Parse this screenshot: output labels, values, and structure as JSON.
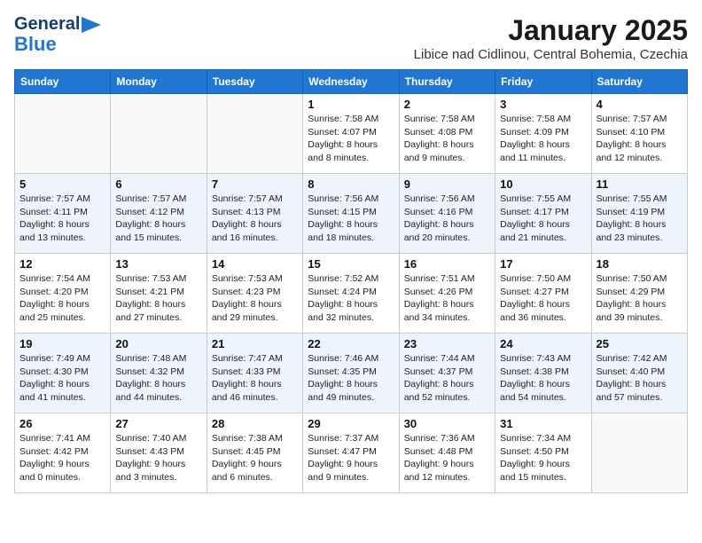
{
  "logo": {
    "line1": "General",
    "line2": "Blue",
    "flag_shape": "triangle"
  },
  "title": "January 2025",
  "subtitle": "Libice nad Cidlinou, Central Bohemia, Czechia",
  "days_of_week": [
    "Sunday",
    "Monday",
    "Tuesday",
    "Wednesday",
    "Thursday",
    "Friday",
    "Saturday"
  ],
  "weeks": [
    [
      {
        "day": "",
        "info": ""
      },
      {
        "day": "",
        "info": ""
      },
      {
        "day": "",
        "info": ""
      },
      {
        "day": "1",
        "info": "Sunrise: 7:58 AM\nSunset: 4:07 PM\nDaylight: 8 hours and 8 minutes."
      },
      {
        "day": "2",
        "info": "Sunrise: 7:58 AM\nSunset: 4:08 PM\nDaylight: 8 hours and 9 minutes."
      },
      {
        "day": "3",
        "info": "Sunrise: 7:58 AM\nSunset: 4:09 PM\nDaylight: 8 hours and 11 minutes."
      },
      {
        "day": "4",
        "info": "Sunrise: 7:57 AM\nSunset: 4:10 PM\nDaylight: 8 hours and 12 minutes."
      }
    ],
    [
      {
        "day": "5",
        "info": "Sunrise: 7:57 AM\nSunset: 4:11 PM\nDaylight: 8 hours and 13 minutes."
      },
      {
        "day": "6",
        "info": "Sunrise: 7:57 AM\nSunset: 4:12 PM\nDaylight: 8 hours and 15 minutes."
      },
      {
        "day": "7",
        "info": "Sunrise: 7:57 AM\nSunset: 4:13 PM\nDaylight: 8 hours and 16 minutes."
      },
      {
        "day": "8",
        "info": "Sunrise: 7:56 AM\nSunset: 4:15 PM\nDaylight: 8 hours and 18 minutes."
      },
      {
        "day": "9",
        "info": "Sunrise: 7:56 AM\nSunset: 4:16 PM\nDaylight: 8 hours and 20 minutes."
      },
      {
        "day": "10",
        "info": "Sunrise: 7:55 AM\nSunset: 4:17 PM\nDaylight: 8 hours and 21 minutes."
      },
      {
        "day": "11",
        "info": "Sunrise: 7:55 AM\nSunset: 4:19 PM\nDaylight: 8 hours and 23 minutes."
      }
    ],
    [
      {
        "day": "12",
        "info": "Sunrise: 7:54 AM\nSunset: 4:20 PM\nDaylight: 8 hours and 25 minutes."
      },
      {
        "day": "13",
        "info": "Sunrise: 7:53 AM\nSunset: 4:21 PM\nDaylight: 8 hours and 27 minutes."
      },
      {
        "day": "14",
        "info": "Sunrise: 7:53 AM\nSunset: 4:23 PM\nDaylight: 8 hours and 29 minutes."
      },
      {
        "day": "15",
        "info": "Sunrise: 7:52 AM\nSunset: 4:24 PM\nDaylight: 8 hours and 32 minutes."
      },
      {
        "day": "16",
        "info": "Sunrise: 7:51 AM\nSunset: 4:26 PM\nDaylight: 8 hours and 34 minutes."
      },
      {
        "day": "17",
        "info": "Sunrise: 7:50 AM\nSunset: 4:27 PM\nDaylight: 8 hours and 36 minutes."
      },
      {
        "day": "18",
        "info": "Sunrise: 7:50 AM\nSunset: 4:29 PM\nDaylight: 8 hours and 39 minutes."
      }
    ],
    [
      {
        "day": "19",
        "info": "Sunrise: 7:49 AM\nSunset: 4:30 PM\nDaylight: 8 hours and 41 minutes."
      },
      {
        "day": "20",
        "info": "Sunrise: 7:48 AM\nSunset: 4:32 PM\nDaylight: 8 hours and 44 minutes."
      },
      {
        "day": "21",
        "info": "Sunrise: 7:47 AM\nSunset: 4:33 PM\nDaylight: 8 hours and 46 minutes."
      },
      {
        "day": "22",
        "info": "Sunrise: 7:46 AM\nSunset: 4:35 PM\nDaylight: 8 hours and 49 minutes."
      },
      {
        "day": "23",
        "info": "Sunrise: 7:44 AM\nSunset: 4:37 PM\nDaylight: 8 hours and 52 minutes."
      },
      {
        "day": "24",
        "info": "Sunrise: 7:43 AM\nSunset: 4:38 PM\nDaylight: 8 hours and 54 minutes."
      },
      {
        "day": "25",
        "info": "Sunrise: 7:42 AM\nSunset: 4:40 PM\nDaylight: 8 hours and 57 minutes."
      }
    ],
    [
      {
        "day": "26",
        "info": "Sunrise: 7:41 AM\nSunset: 4:42 PM\nDaylight: 9 hours and 0 minutes."
      },
      {
        "day": "27",
        "info": "Sunrise: 7:40 AM\nSunset: 4:43 PM\nDaylight: 9 hours and 3 minutes."
      },
      {
        "day": "28",
        "info": "Sunrise: 7:38 AM\nSunset: 4:45 PM\nDaylight: 9 hours and 6 minutes."
      },
      {
        "day": "29",
        "info": "Sunrise: 7:37 AM\nSunset: 4:47 PM\nDaylight: 9 hours and 9 minutes."
      },
      {
        "day": "30",
        "info": "Sunrise: 7:36 AM\nSunset: 4:48 PM\nDaylight: 9 hours and 12 minutes."
      },
      {
        "day": "31",
        "info": "Sunrise: 7:34 AM\nSunset: 4:50 PM\nDaylight: 9 hours and 15 minutes."
      },
      {
        "day": "",
        "info": ""
      }
    ]
  ]
}
